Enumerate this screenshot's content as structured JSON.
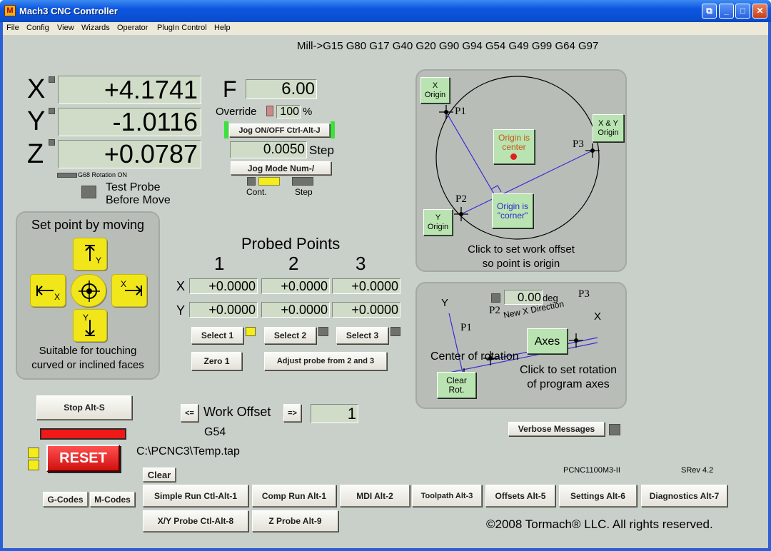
{
  "window": {
    "title": "Mach3 CNC Controller",
    "icon": "M"
  },
  "menu": [
    "File",
    "Config",
    "View",
    "Wizards",
    "Operator",
    "PlugIn Control",
    "Help"
  ],
  "gcode_line": "Mill->G15  G80 G17 G40 G20 G90 G94 G54 G49 G99 G64 G97",
  "dro": {
    "x_label": "X",
    "y_label": "Y",
    "z_label": "Z",
    "x": "+4.1741",
    "y": "-1.0116",
    "z": "+0.0787",
    "g68_label": "G68 Rotation ON"
  },
  "feed": {
    "label": "F",
    "value": "6.00",
    "override_label": "Override",
    "override_value": "100",
    "percent": "%"
  },
  "jog": {
    "onoff_btn": "Jog ON/OFF Ctrl-Alt-J",
    "step_value": "0.0050",
    "step_label": "Step",
    "mode_btn": "Jog Mode Num-/",
    "cont_label": "Cont.",
    "step_mode_label": "Step"
  },
  "test_probe": "Test Probe\nBefore Move",
  "set_point": {
    "title": "Set point by moving",
    "up_y": "Y",
    "left_x": "X",
    "right_x": "X",
    "down_y": "Y",
    "caption": "Suitable for touching\ncurved or inclined faces"
  },
  "probed": {
    "title": "Probed Points",
    "cols": [
      "1",
      "2",
      "3"
    ],
    "x_label": "X",
    "y_label": "Y",
    "x": [
      "+0.0000",
      "+0.0000",
      "+0.0000"
    ],
    "y": [
      "+0.0000",
      "+0.0000",
      "+0.0000"
    ],
    "select": [
      "Select 1",
      "Select 2",
      "Select 3"
    ],
    "zero1": "Zero 1",
    "adjust": "Adjust probe from 2 and 3"
  },
  "circle_panel": {
    "x_origin": "X\nOrigin",
    "y_origin": "Y\nOrigin",
    "xy_origin": "X & Y\nOrigin",
    "origin_center": "Origin is\ncenter",
    "origin_corner": "Origin is\n\"corner\"",
    "p1": "P1",
    "p2": "P2",
    "p3": "P3",
    "caption": "Click to set work offset\nso point is origin"
  },
  "rotation_panel": {
    "deg_value": "0.00",
    "deg_label": "deg",
    "y": "Y",
    "x": "X",
    "p1": "P1",
    "p2": "P2",
    "p3": "P3",
    "new_x_dir": "New X Direction",
    "center": "Center of rotation",
    "axes_btn": "Axes",
    "caption": "Click to set rotation\nof program axes",
    "clear_rot": "Clear\nRot."
  },
  "stop_btn": "Stop Alt-S",
  "reset_btn": "RESET",
  "work_offset": {
    "prev": "<=",
    "label": "Work Offset",
    "next": "=>",
    "value": "1",
    "gcode": "G54"
  },
  "file_path": "C:\\PCNC3\\Temp.tap",
  "verbose_btn": "Verbose Messages",
  "clear_btn": "Clear",
  "model": "PCNC1100M3-II",
  "srev": "SRev 4.2",
  "gcodes_btn": "G-Codes",
  "mcodes_btn": "M-Codes",
  "screens": [
    "Simple Run Ctl-Alt-1",
    "Comp Run Alt-1",
    "MDI Alt-2",
    "Toolpath Alt-3",
    "Offsets Alt-5",
    "Settings Alt-6",
    "Diagnostics Alt-7"
  ],
  "probe_screens": [
    "X/Y Probe Ctl-Alt-8",
    "Z Probe Alt-9"
  ],
  "copyright": "©2008 Tormach® LLC. All rights reserved.",
  "colors": {
    "title_bar": "#0a4fd0",
    "background": "#c9cfc9",
    "dro_bg": "#d0dcc8",
    "reset_red": "#e02020",
    "jog_yellow": "#f0e61a",
    "green_button": "#b9e3b1"
  }
}
